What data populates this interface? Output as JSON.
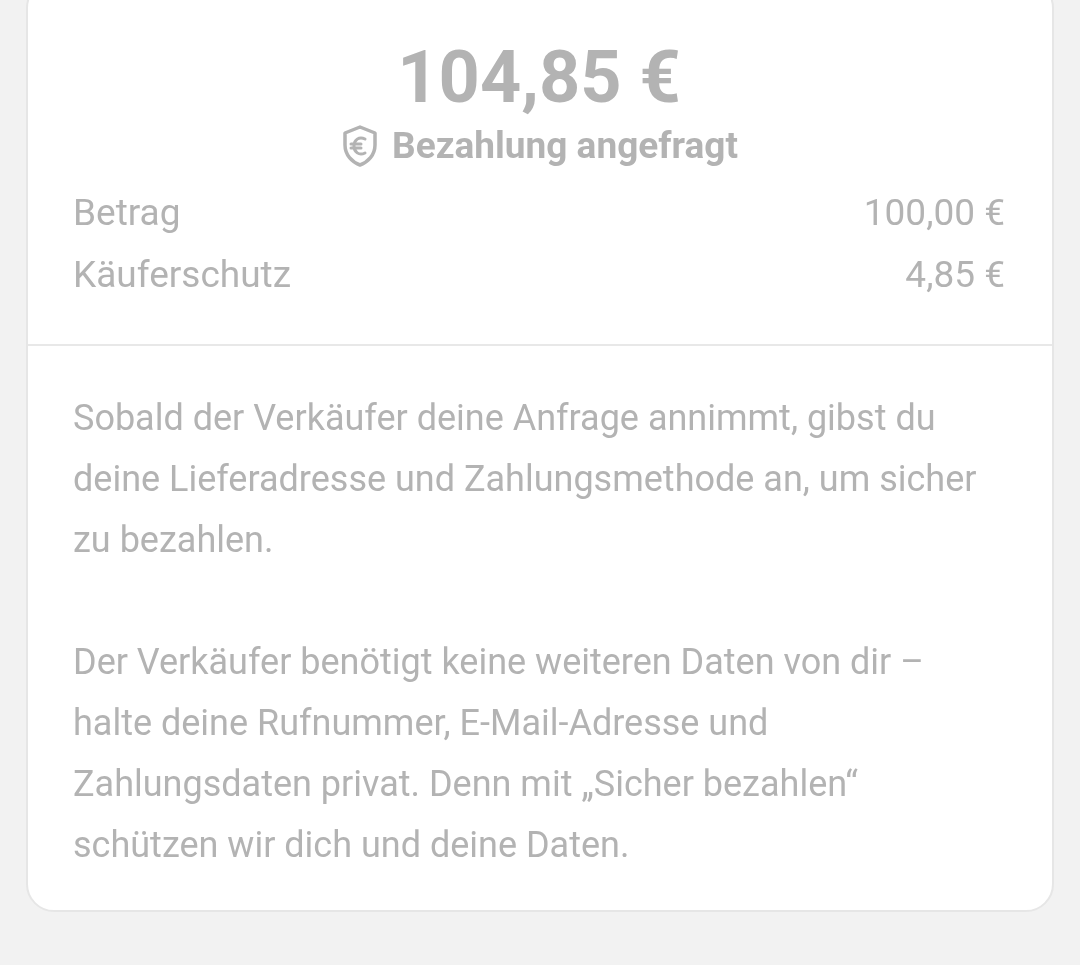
{
  "total": "104,85 €",
  "status": "Bezahlung angefragt",
  "lines": [
    {
      "label": "Betrag",
      "value": "100,00 €"
    },
    {
      "label": "Käuferschutz",
      "value": "4,85 €"
    }
  ],
  "paragraphs": [
    "Sobald der Verkäufer deine Anfrage annimmt, gibst du deine Lieferadresse und Zahlungsmethode an, um sicher zu bezahlen.",
    "Der Verkäufer benötigt keine weiteren Daten von dir – halte deine Rufnummer, E-Mail-Adresse und Zahlungsdaten privat. Denn mit „Sicher bezahlen“ schützen wir dich und deine Daten."
  ]
}
